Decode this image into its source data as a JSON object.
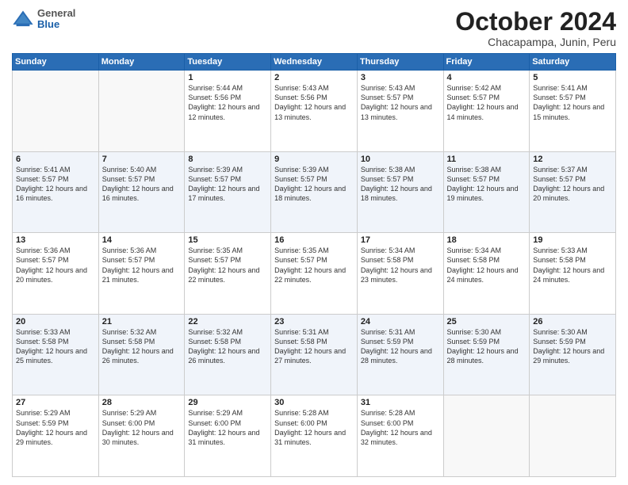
{
  "logo": {
    "general": "General",
    "blue": "Blue"
  },
  "header": {
    "month": "October 2024",
    "location": "Chacapampa, Junin, Peru"
  },
  "weekdays": [
    "Sunday",
    "Monday",
    "Tuesday",
    "Wednesday",
    "Thursday",
    "Friday",
    "Saturday"
  ],
  "weeks": [
    [
      {
        "day": "",
        "sunrise": "",
        "sunset": "",
        "daylight": ""
      },
      {
        "day": "",
        "sunrise": "",
        "sunset": "",
        "daylight": ""
      },
      {
        "day": "1",
        "sunrise": "Sunrise: 5:44 AM",
        "sunset": "Sunset: 5:56 PM",
        "daylight": "Daylight: 12 hours and 12 minutes."
      },
      {
        "day": "2",
        "sunrise": "Sunrise: 5:43 AM",
        "sunset": "Sunset: 5:56 PM",
        "daylight": "Daylight: 12 hours and 13 minutes."
      },
      {
        "day": "3",
        "sunrise": "Sunrise: 5:43 AM",
        "sunset": "Sunset: 5:57 PM",
        "daylight": "Daylight: 12 hours and 13 minutes."
      },
      {
        "day": "4",
        "sunrise": "Sunrise: 5:42 AM",
        "sunset": "Sunset: 5:57 PM",
        "daylight": "Daylight: 12 hours and 14 minutes."
      },
      {
        "day": "5",
        "sunrise": "Sunrise: 5:41 AM",
        "sunset": "Sunset: 5:57 PM",
        "daylight": "Daylight: 12 hours and 15 minutes."
      }
    ],
    [
      {
        "day": "6",
        "sunrise": "Sunrise: 5:41 AM",
        "sunset": "Sunset: 5:57 PM",
        "daylight": "Daylight: 12 hours and 16 minutes."
      },
      {
        "day": "7",
        "sunrise": "Sunrise: 5:40 AM",
        "sunset": "Sunset: 5:57 PM",
        "daylight": "Daylight: 12 hours and 16 minutes."
      },
      {
        "day": "8",
        "sunrise": "Sunrise: 5:39 AM",
        "sunset": "Sunset: 5:57 PM",
        "daylight": "Daylight: 12 hours and 17 minutes."
      },
      {
        "day": "9",
        "sunrise": "Sunrise: 5:39 AM",
        "sunset": "Sunset: 5:57 PM",
        "daylight": "Daylight: 12 hours and 18 minutes."
      },
      {
        "day": "10",
        "sunrise": "Sunrise: 5:38 AM",
        "sunset": "Sunset: 5:57 PM",
        "daylight": "Daylight: 12 hours and 18 minutes."
      },
      {
        "day": "11",
        "sunrise": "Sunrise: 5:38 AM",
        "sunset": "Sunset: 5:57 PM",
        "daylight": "Daylight: 12 hours and 19 minutes."
      },
      {
        "day": "12",
        "sunrise": "Sunrise: 5:37 AM",
        "sunset": "Sunset: 5:57 PM",
        "daylight": "Daylight: 12 hours and 20 minutes."
      }
    ],
    [
      {
        "day": "13",
        "sunrise": "Sunrise: 5:36 AM",
        "sunset": "Sunset: 5:57 PM",
        "daylight": "Daylight: 12 hours and 20 minutes."
      },
      {
        "day": "14",
        "sunrise": "Sunrise: 5:36 AM",
        "sunset": "Sunset: 5:57 PM",
        "daylight": "Daylight: 12 hours and 21 minutes."
      },
      {
        "day": "15",
        "sunrise": "Sunrise: 5:35 AM",
        "sunset": "Sunset: 5:57 PM",
        "daylight": "Daylight: 12 hours and 22 minutes."
      },
      {
        "day": "16",
        "sunrise": "Sunrise: 5:35 AM",
        "sunset": "Sunset: 5:57 PM",
        "daylight": "Daylight: 12 hours and 22 minutes."
      },
      {
        "day": "17",
        "sunrise": "Sunrise: 5:34 AM",
        "sunset": "Sunset: 5:58 PM",
        "daylight": "Daylight: 12 hours and 23 minutes."
      },
      {
        "day": "18",
        "sunrise": "Sunrise: 5:34 AM",
        "sunset": "Sunset: 5:58 PM",
        "daylight": "Daylight: 12 hours and 24 minutes."
      },
      {
        "day": "19",
        "sunrise": "Sunrise: 5:33 AM",
        "sunset": "Sunset: 5:58 PM",
        "daylight": "Daylight: 12 hours and 24 minutes."
      }
    ],
    [
      {
        "day": "20",
        "sunrise": "Sunrise: 5:33 AM",
        "sunset": "Sunset: 5:58 PM",
        "daylight": "Daylight: 12 hours and 25 minutes."
      },
      {
        "day": "21",
        "sunrise": "Sunrise: 5:32 AM",
        "sunset": "Sunset: 5:58 PM",
        "daylight": "Daylight: 12 hours and 26 minutes."
      },
      {
        "day": "22",
        "sunrise": "Sunrise: 5:32 AM",
        "sunset": "Sunset: 5:58 PM",
        "daylight": "Daylight: 12 hours and 26 minutes."
      },
      {
        "day": "23",
        "sunrise": "Sunrise: 5:31 AM",
        "sunset": "Sunset: 5:58 PM",
        "daylight": "Daylight: 12 hours and 27 minutes."
      },
      {
        "day": "24",
        "sunrise": "Sunrise: 5:31 AM",
        "sunset": "Sunset: 5:59 PM",
        "daylight": "Daylight: 12 hours and 28 minutes."
      },
      {
        "day": "25",
        "sunrise": "Sunrise: 5:30 AM",
        "sunset": "Sunset: 5:59 PM",
        "daylight": "Daylight: 12 hours and 28 minutes."
      },
      {
        "day": "26",
        "sunrise": "Sunrise: 5:30 AM",
        "sunset": "Sunset: 5:59 PM",
        "daylight": "Daylight: 12 hours and 29 minutes."
      }
    ],
    [
      {
        "day": "27",
        "sunrise": "Sunrise: 5:29 AM",
        "sunset": "Sunset: 5:59 PM",
        "daylight": "Daylight: 12 hours and 29 minutes."
      },
      {
        "day": "28",
        "sunrise": "Sunrise: 5:29 AM",
        "sunset": "Sunset: 6:00 PM",
        "daylight": "Daylight: 12 hours and 30 minutes."
      },
      {
        "day": "29",
        "sunrise": "Sunrise: 5:29 AM",
        "sunset": "Sunset: 6:00 PM",
        "daylight": "Daylight: 12 hours and 31 minutes."
      },
      {
        "day": "30",
        "sunrise": "Sunrise: 5:28 AM",
        "sunset": "Sunset: 6:00 PM",
        "daylight": "Daylight: 12 hours and 31 minutes."
      },
      {
        "day": "31",
        "sunrise": "Sunrise: 5:28 AM",
        "sunset": "Sunset: 6:00 PM",
        "daylight": "Daylight: 12 hours and 32 minutes."
      },
      {
        "day": "",
        "sunrise": "",
        "sunset": "",
        "daylight": ""
      },
      {
        "day": "",
        "sunrise": "",
        "sunset": "",
        "daylight": ""
      }
    ]
  ]
}
